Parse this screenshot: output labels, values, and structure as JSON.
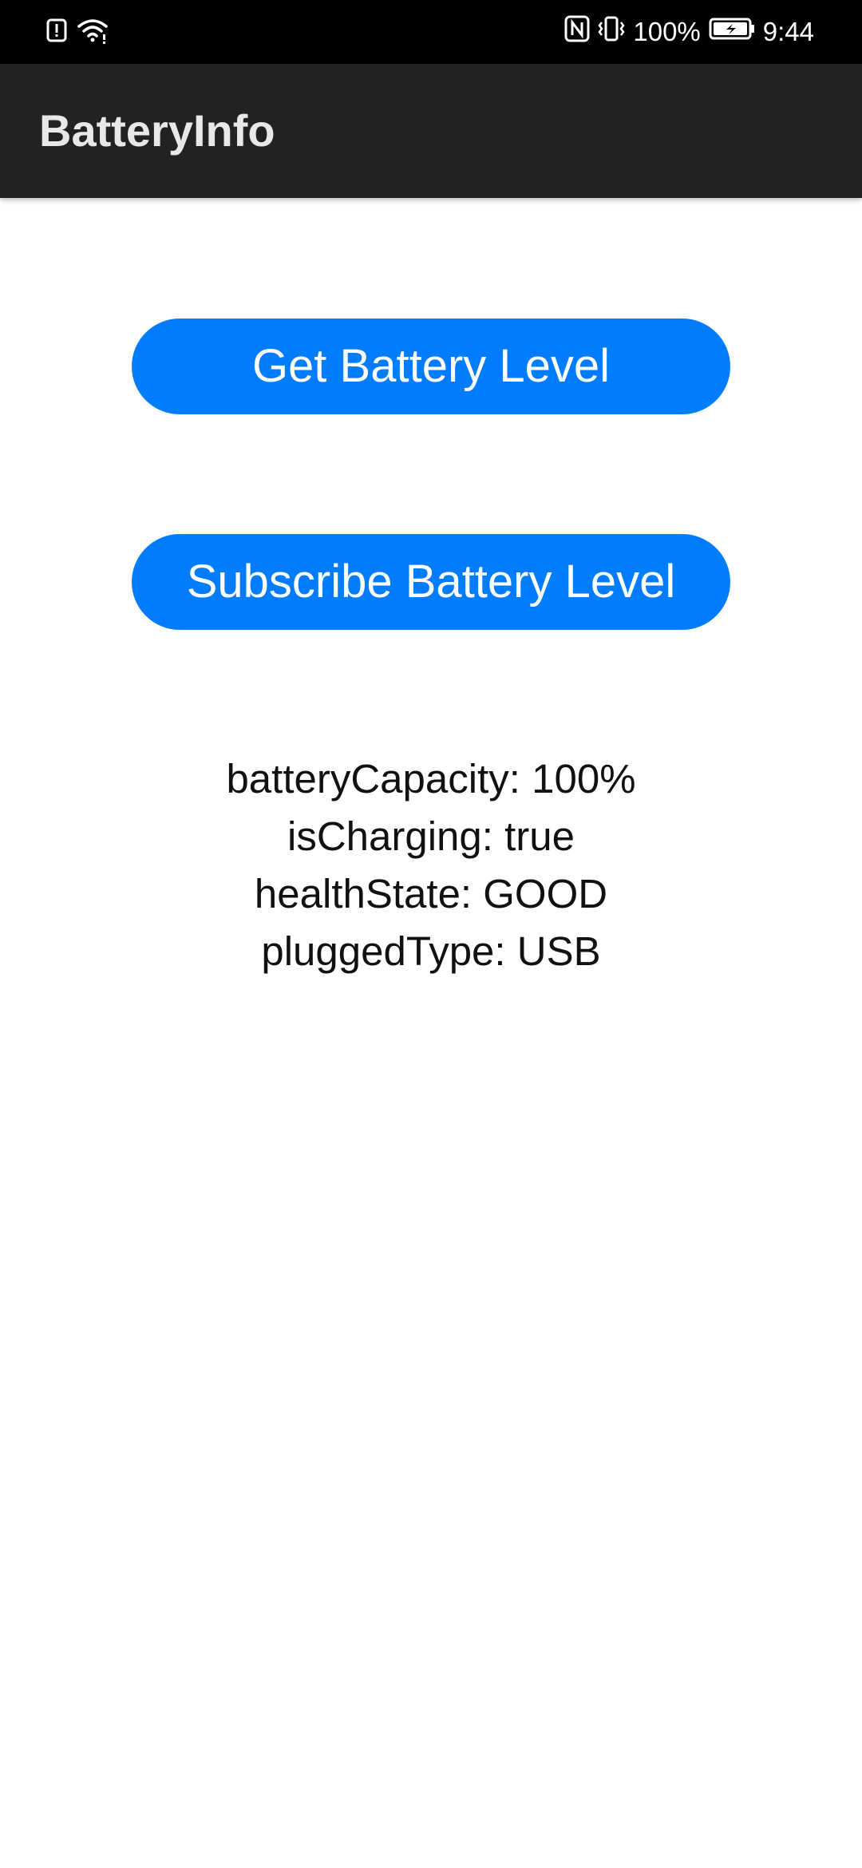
{
  "status_bar": {
    "battery_percent": "100%",
    "time": "9:44",
    "icons": [
      "alert-icon",
      "wifi-icon",
      "nfc-icon",
      "vibrate-icon",
      "battery-charging-icon"
    ]
  },
  "app_bar": {
    "title": "BatteryInfo"
  },
  "buttons": {
    "get_battery_level": "Get Battery Level",
    "subscribe_battery_level": "Subscribe Battery Level"
  },
  "info": {
    "battery_capacity": "batteryCapacity: 100%",
    "is_charging": "isCharging: true",
    "health_state": "healthState: GOOD",
    "plugged_type": "pluggedType: USB"
  },
  "colors": {
    "accent": "#007dff",
    "app_bar": "#222222",
    "status_bar": "#000000"
  }
}
